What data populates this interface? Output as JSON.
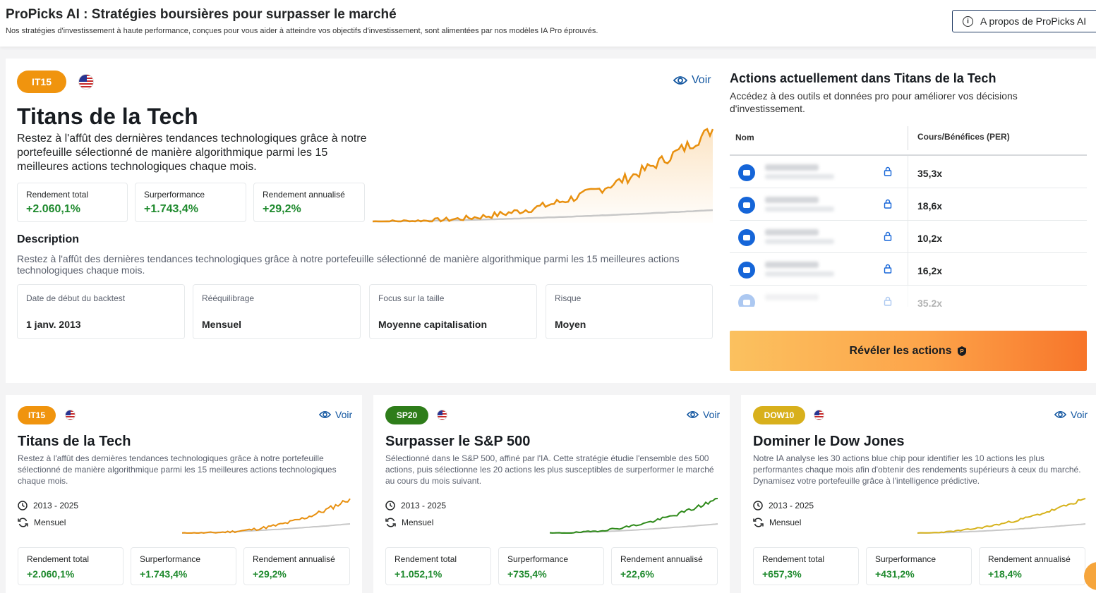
{
  "header": {
    "title": "ProPicks AI : Stratégies boursières pour surpasser le marché",
    "subtitle": "Nos stratégies d'investissement à haute performance, conçues pour vous aider à atteindre vos objectifs d'investissement, sont alimentées par nos modèles IA Pro éprouvés.",
    "about_button": "A propos de ProPicks AI"
  },
  "featured": {
    "tag": "IT15",
    "tag_color": "#f0940e",
    "voir": "Voir",
    "title": "Titans de la Tech",
    "summary": "Restez à l'affût des dernières tendances technologiques grâce à notre portefeuille sélectionné de manière algorithmique parmi les 15 meilleures actions technologiques chaque mois.",
    "stats": [
      {
        "label": "Rendement total",
        "value": "+2.060,1%"
      },
      {
        "label": "Surperformance",
        "value": "+1.743,4%"
      },
      {
        "label": "Rendement annualisé",
        "value": "+29,2%"
      }
    ],
    "description_heading": "Description",
    "description": "Restez à l'affût des dernières tendances technologiques grâce à notre portefeuille sélectionné de manière algorithmique parmi les 15 meilleures actions technologiques chaque mois.",
    "info": [
      {
        "label": "Date de début du backtest",
        "value": "1 janv. 2013"
      },
      {
        "label": "Rééquilibrage",
        "value": "Mensuel"
      },
      {
        "label": "Focus sur la taille",
        "value": "Moyenne capitalisation"
      },
      {
        "label": "Risque",
        "value": "Moyen"
      }
    ]
  },
  "holdings": {
    "title": "Actions actuellement dans Titans de la Tech",
    "subtitle": "Accédez à des outils et données pro pour améliorer vos décisions d'investissement.",
    "col_name": "Nom",
    "col_per": "Cours/Bénéfices (PER)",
    "rows": [
      {
        "per": "35,3x"
      },
      {
        "per": "18,6x"
      },
      {
        "per": "10,2x"
      },
      {
        "per": "16,2x"
      },
      {
        "per": "35,2x"
      }
    ],
    "reveal_button": "Révéler les actions"
  },
  "cards": [
    {
      "tag": "IT15",
      "tag_color": "#f0940e",
      "line_color": "#e8900f",
      "voir": "Voir",
      "title": "Titans de la Tech",
      "description": "Restez à l'affût des dernières tendances technologiques grâce à notre portefeuille sélectionné de manière algorithmique parmi les 15 meilleures actions technologiques chaque mois.",
      "period": "2013 - 2025",
      "rebalance": "Mensuel",
      "stats": [
        {
          "label": "Rendement total",
          "value": "+2.060,1%"
        },
        {
          "label": "Surperformance",
          "value": "+1.743,4%"
        },
        {
          "label": "Rendement annualisé",
          "value": "+29,2%"
        }
      ]
    },
    {
      "tag": "SP20",
      "tag_color": "#2e7d1a",
      "line_color": "#2e8a1a",
      "voir": "Voir",
      "title": "Surpasser le S&P 500",
      "description": "Sélectionné dans le S&P 500, affiné par l'IA. Cette stratégie étudie l'ensemble des 500 actions, puis sélectionne les 20 actions les plus susceptibles de surperformer le marché au cours du mois suivant.",
      "period": "2013 - 2025",
      "rebalance": "Mensuel",
      "stats": [
        {
          "label": "Rendement total",
          "value": "+1.052,1%"
        },
        {
          "label": "Surperformance",
          "value": "+735,4%"
        },
        {
          "label": "Rendement annualisé",
          "value": "+22,6%"
        }
      ]
    },
    {
      "tag": "DOW10",
      "tag_color": "#d8b01c",
      "line_color": "#d6b21c",
      "voir": "Voir",
      "title": "Dominer le Dow Jones",
      "description": "Notre IA analyse les 30 actions blue chip pour identifier les 10 actions les plus performantes chaque mois afin d'obtenir des rendements supérieurs à ceux du marché. Dynamisez votre portefeuille grâce à l'intelligence prédictive.",
      "period": "2013 - 2025",
      "rebalance": "Mensuel",
      "stats": [
        {
          "label": "Rendement total",
          "value": "+657,3%"
        },
        {
          "label": "Surperformance",
          "value": "+431,2%"
        },
        {
          "label": "Rendement annualisé",
          "value": "+18,4%"
        }
      ]
    }
  ],
  "colors": {
    "positive": "#1f8a2e",
    "link": "#1256a0",
    "benchmark_line": "#c8c8c8"
  }
}
